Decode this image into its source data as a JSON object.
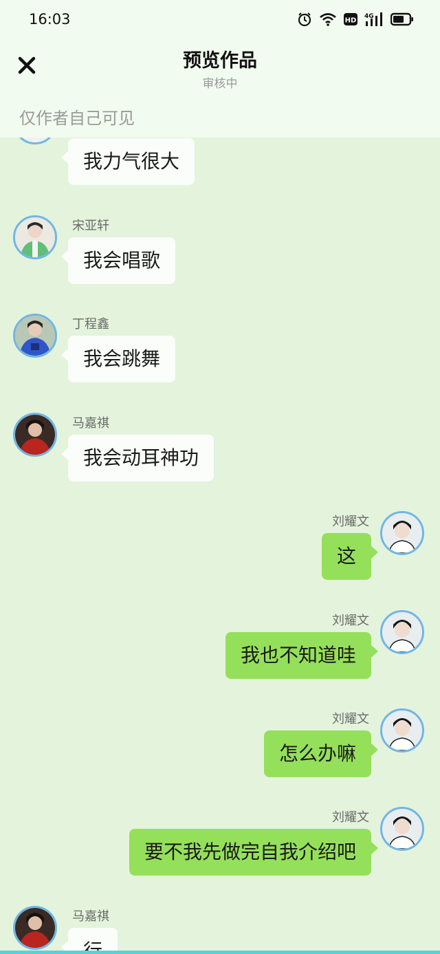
{
  "status_bar": {
    "time": "16:03",
    "network": "4G",
    "hd": "HD"
  },
  "header": {
    "title": "预览作品",
    "subtitle": "审核中",
    "notice": "仅作者自己可见"
  },
  "colors": {
    "header_bg": "#f2fbef",
    "chat_bg": "#e4f3dc",
    "self_bubble": "#95e05a",
    "other_bubble": "#fafdf9",
    "avatar_border": "#6fb6e6"
  },
  "messages": [
    {
      "side": "left",
      "name": "",
      "text": "我力气很大"
    },
    {
      "side": "left",
      "name": "宋亚轩",
      "text": "我会唱歌"
    },
    {
      "side": "left",
      "name": "丁程鑫",
      "text": "我会跳舞"
    },
    {
      "side": "left",
      "name": "马嘉祺",
      "text": "我会动耳神功"
    },
    {
      "side": "right",
      "name": "刘耀文",
      "text": "这"
    },
    {
      "side": "right",
      "name": "刘耀文",
      "text": "我也不知道哇"
    },
    {
      "side": "right",
      "name": "刘耀文",
      "text": "怎么办嘛"
    },
    {
      "side": "right",
      "name": "刘耀文",
      "text": "要不我先做完自我介绍吧"
    },
    {
      "side": "left",
      "name": "马嘉祺",
      "text": "行"
    }
  ]
}
